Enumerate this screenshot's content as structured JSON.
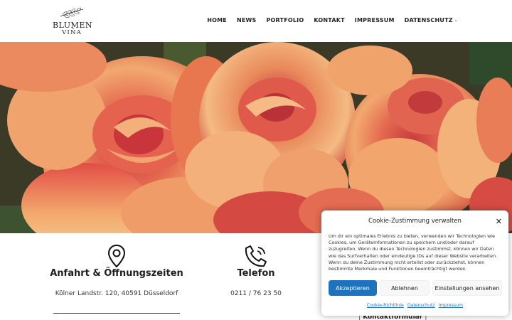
{
  "brand": {
    "line1": "BLUMEN",
    "line2": "VIÑA"
  },
  "nav": {
    "items": [
      {
        "label": "HOME"
      },
      {
        "label": "NEWS"
      },
      {
        "label": "PORTFOLIO"
      },
      {
        "label": "KONTAKT"
      },
      {
        "label": "IMPRESSUM"
      },
      {
        "label": "DATENSCHUTZ"
      }
    ],
    "dropdown_icon": "chevron-down-icon"
  },
  "hero": {
    "image": "roses-photo"
  },
  "info": {
    "address": {
      "icon": "map-pin-icon",
      "title": "Anfahrt & Öffnungszeiten",
      "text": "Kölner Landstr. 120, 40591 Düsseldorf"
    },
    "phone": {
      "icon": "phone-icon",
      "title": "Telefon",
      "text": "0211 / 76 23 50"
    },
    "contact_link": "Kontaktformular"
  },
  "cookie": {
    "title": "Cookie-Zustimmung verwalten",
    "text": "Um dir ein optimales Erlebnis zu bieten, verwenden wir Technologien wie Cookies, um Geräteinformationen zu speichern und/oder darauf zuzugreifen. Wenn du diesen Technologien zustimmst, können wir Daten wie das Surfverhalten oder eindeutige IDs auf dieser Website verarbeiten. Wenn du deine Zustimmung nicht erteilst oder zurückziehst, können bestimmte Merkmale und Funktionen beeinträchtigt werden.",
    "accept": "Akzeptieren",
    "deny": "Ablehnen",
    "settings": "Einstellungen ansehen",
    "links": [
      "Cookie-Richtlinie",
      "Datenschutz",
      "Impressum"
    ],
    "accent_color": "#1e73be"
  }
}
